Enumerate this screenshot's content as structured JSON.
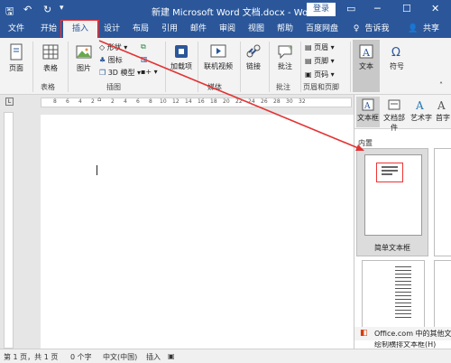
{
  "app": {
    "title": "新建 Microsoft Word 文档.docx - Word",
    "login": "登录"
  },
  "menu": {
    "tabs": [
      "文件",
      "开始",
      "插入",
      "设计",
      "布局",
      "引用",
      "邮件",
      "审阅",
      "视图",
      "帮助",
      "百度网盘"
    ],
    "active": "插入",
    "tell_me": "告诉我",
    "share": "共享"
  },
  "ribbon": {
    "page_btn": "页面",
    "table_btn": "表格",
    "picture_btn": "图片",
    "shape_btn": "形状",
    "icon_btn": "图标",
    "model3d_btn": "3D 模型",
    "addin_btn": "加载项",
    "online_video_btn": "联机视频",
    "link_btn": "链接",
    "comment_btn": "批注",
    "header_btn": "页眉",
    "footer_btn": "页脚",
    "page_number_btn": "页码",
    "text_btn": "文本",
    "symbol_btn": "符号",
    "groups": {
      "table": "表格",
      "illustrations": "插图",
      "media": "媒体",
      "comments": "批注",
      "header_footer": "页眉和页脚"
    }
  },
  "ruler": {
    "numbers": [
      "8",
      "6",
      "4",
      "2",
      "2",
      "4",
      "6",
      "8",
      "10",
      "12",
      "14",
      "16",
      "18",
      "20",
      "22",
      "24",
      "26",
      "28",
      "30",
      "32"
    ]
  },
  "panel": {
    "textbox_btn": "文本框",
    "quickparts_btn": "文档部件",
    "wordart_btn": "艺术字",
    "dropcap_btn": "首字",
    "section": "内置",
    "simple_textbox": "简单文本框",
    "more_office": "Office.com 中的其他文本框",
    "draw_textbox": "绘制横排文本框(H)"
  },
  "status": {
    "pages": "第 1 页，共 1 页",
    "words": "0 个字",
    "language": "中文(中国)",
    "mode": "插入"
  },
  "colors": {
    "accent": "#2b579a",
    "annotation": "#e33333"
  }
}
